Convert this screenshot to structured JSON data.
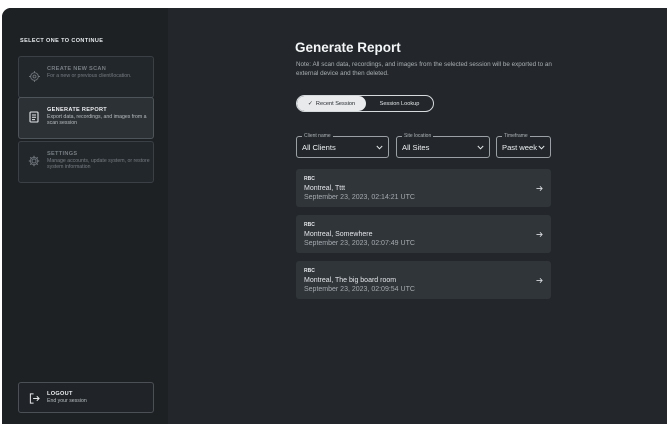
{
  "sidebar": {
    "heading": "SELECT ONE TO CONTINUE",
    "items": [
      {
        "title": "CREATE NEW SCAN",
        "desc": "For a new or previous client/location.",
        "icon": "crosshair-icon",
        "state": "disabled"
      },
      {
        "title": "GENERATE REPORT",
        "desc": "Export data, recordings, and images from a scan session",
        "icon": "report-icon",
        "state": "active"
      },
      {
        "title": "SETTINGS",
        "desc": "Manage accounts, update system, or restore system information",
        "icon": "gear-icon",
        "state": "disabled"
      }
    ],
    "logout": {
      "title": "LOGOUT",
      "desc": "End your session",
      "icon": "logout-icon"
    }
  },
  "main": {
    "title": "Generate Report",
    "note": "Note: All scan data, recordings, and images from the selected session will be exported to an external device and then deleted.",
    "tabs": [
      {
        "label": "Recent Session",
        "selected": true
      },
      {
        "label": "Session Lookup",
        "selected": false
      }
    ],
    "filters": {
      "client": {
        "label": "Client name",
        "value": "All Clients"
      },
      "site": {
        "label": "Site location",
        "value": "All Sites"
      },
      "timeframe": {
        "label": "Timeframe",
        "value": "Past week"
      }
    },
    "sessions": [
      {
        "code": "RBC",
        "place": "Montreal, Tttt",
        "date": "September 23, 2023, 02:14:21 UTC"
      },
      {
        "code": "RBC",
        "place": "Montreal, Somewhere",
        "date": "September 23, 2023, 02:07:49 UTC"
      },
      {
        "code": "RBC",
        "place": "Montreal, The big board room",
        "date": "September 23, 2023, 02:09:54 UTC"
      }
    ]
  },
  "colors": {
    "background": "#23272b",
    "sidebar": "#1d2124",
    "card": "#30353a",
    "accent": "#e8eaec"
  }
}
